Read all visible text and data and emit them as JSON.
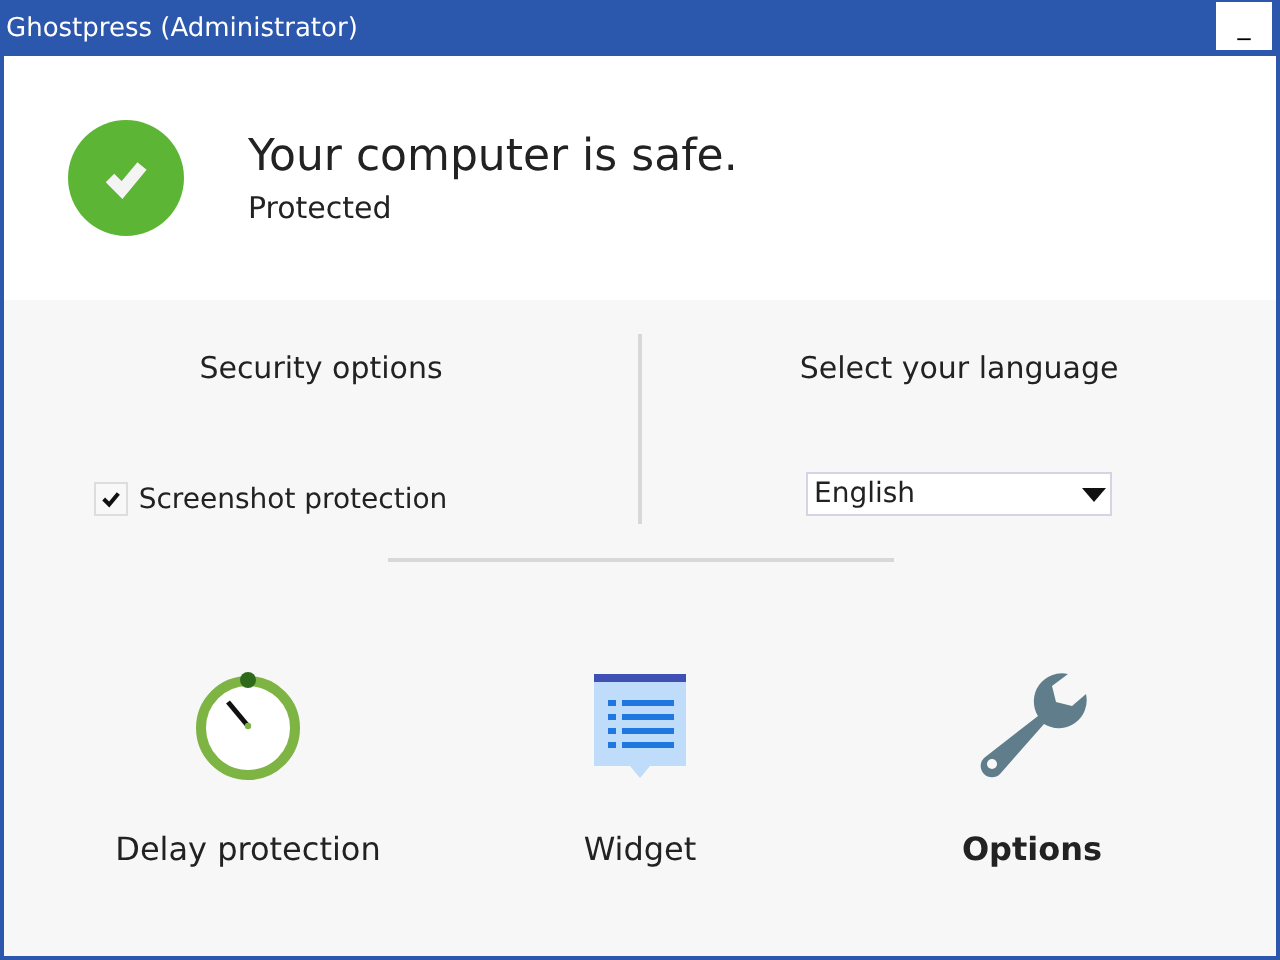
{
  "window": {
    "title": "Ghostpress (Administrator)",
    "minimize": "_"
  },
  "status": {
    "kind": "safe",
    "headline": "Your computer is safe.",
    "detail": "Protected"
  },
  "security": {
    "heading": "Security options",
    "options": [
      {
        "label": "Screenshot protection",
        "checked": true
      }
    ]
  },
  "language": {
    "heading": "Select your language",
    "value": "English"
  },
  "nav": [
    {
      "kind": "timer",
      "label": "Delay protection",
      "selected": false
    },
    {
      "kind": "widget",
      "label": "Widget",
      "selected": false
    },
    {
      "kind": "wrench",
      "label": "Options",
      "selected": true
    }
  ]
}
